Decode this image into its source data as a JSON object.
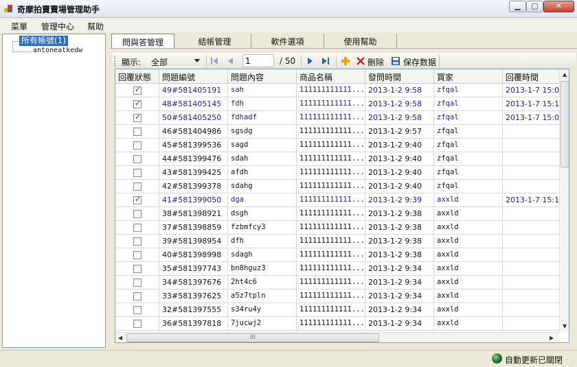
{
  "window": {
    "title": "奇摩拍賣賣場管理助手",
    "min_glyph": "▁",
    "max_glyph": "▢",
    "close_glyph": "✕"
  },
  "menu": [
    "菜單",
    "管理中心",
    "幫助"
  ],
  "tree": {
    "root": "所有帳號(1)",
    "child": "antoneatkedw"
  },
  "tabs": [
    "問與答管理",
    "結帳管理",
    "軟件選項",
    "使用幫助"
  ],
  "active_tab": 0,
  "toolbar": {
    "display_label": "顯示:",
    "filter_value": "全部",
    "page_current": "1",
    "page_total": "/ 50",
    "delete_label": "刪除",
    "save_label": "保存数据"
  },
  "grid": {
    "columns": [
      "回覆狀態",
      "問題編號",
      "問題內容",
      "商品名稱",
      "發問時間",
      "買家",
      "回覆時間"
    ],
    "rows": [
      {
        "replied": true,
        "id": "49#581405191",
        "content": "sah",
        "product": "111111111111...",
        "asked": "2013-1-2 9:58",
        "buyer": "zfqal",
        "reply": "2013-1-7 15:0"
      },
      {
        "replied": true,
        "id": "48#581405145",
        "content": "fdh",
        "product": "111111111111...",
        "asked": "2013-1-2 9:58",
        "buyer": "zfqal",
        "reply": "2013-1-7 15:1"
      },
      {
        "replied": true,
        "id": "50#581405250",
        "content": "fdhadf",
        "product": "111111111111...",
        "asked": "2013-1-2 9:58",
        "buyer": "zfqal",
        "reply": "2013-1-7 15:0"
      },
      {
        "replied": false,
        "id": "46#581404986",
        "content": "sgsdg",
        "product": "111111111111...",
        "asked": "2013-1-2 9:57",
        "buyer": "zfqal",
        "reply": ""
      },
      {
        "replied": false,
        "id": "45#581399536",
        "content": "sagd",
        "product": "111111111111...",
        "asked": "2013-1-2 9:40",
        "buyer": "zfqal",
        "reply": ""
      },
      {
        "replied": false,
        "id": "44#581399476",
        "content": "sdah",
        "product": "111111111111...",
        "asked": "2013-1-2 9:40",
        "buyer": "zfqal",
        "reply": ""
      },
      {
        "replied": false,
        "id": "43#581399425",
        "content": "afdh",
        "product": "111111111111...",
        "asked": "2013-1-2 9:40",
        "buyer": "zfqal",
        "reply": ""
      },
      {
        "replied": false,
        "id": "42#581399378",
        "content": "sdahg",
        "product": "111111111111...",
        "asked": "2013-1-2 9:40",
        "buyer": "zfqal",
        "reply": ""
      },
      {
        "replied": true,
        "id": "41#581399050",
        "content": "dga",
        "product": "111111111111...",
        "asked": "2013-1-2 9:39",
        "buyer": "axxld",
        "reply": "2013-1-7 15:1"
      },
      {
        "replied": false,
        "id": "38#581398921",
        "content": "dsgh",
        "product": "111111111111...",
        "asked": "2013-1-2 9:38",
        "buyer": "axxld",
        "reply": ""
      },
      {
        "replied": false,
        "id": "37#581398859",
        "content": "fzbmfcy3",
        "product": "111111111111...",
        "asked": "2013-1-2 9:38",
        "buyer": "axxld",
        "reply": ""
      },
      {
        "replied": false,
        "id": "39#581398954",
        "content": "dfh",
        "product": "111111111111...",
        "asked": "2013-1-2 9:38",
        "buyer": "axxld",
        "reply": ""
      },
      {
        "replied": false,
        "id": "40#581398998",
        "content": "sdagh",
        "product": "111111111111...",
        "asked": "2013-1-2 9:38",
        "buyer": "axxld",
        "reply": ""
      },
      {
        "replied": false,
        "id": "35#581397743",
        "content": "bn8hguz3",
        "product": "111111111111...",
        "asked": "2013-1-2 9:34",
        "buyer": "axxld",
        "reply": ""
      },
      {
        "replied": false,
        "id": "34#581397676",
        "content": "2ht4c6",
        "product": "111111111111...",
        "asked": "2013-1-2 9:34",
        "buyer": "axxld",
        "reply": ""
      },
      {
        "replied": false,
        "id": "33#581397625",
        "content": "a5z7tpln",
        "product": "111111111111...",
        "asked": "2013-1-2 9:34",
        "buyer": "axxld",
        "reply": ""
      },
      {
        "replied": false,
        "id": "32#581397555",
        "content": "s34ru4y",
        "product": "111111111111...",
        "asked": "2013-1-2 9:34",
        "buyer": "axxld",
        "reply": ""
      },
      {
        "replied": false,
        "id": "36#581397818",
        "content": "7jucwj2",
        "product": "111111111111...",
        "asked": "2013-1-2 9:34",
        "buyer": "axxld",
        "reply": ""
      }
    ],
    "scroll_thumb_label": "III"
  },
  "status": {
    "text": "自動更新已關閉"
  },
  "colors": {
    "replied_text": "#1a1aa8",
    "selection": "#316ac5"
  }
}
